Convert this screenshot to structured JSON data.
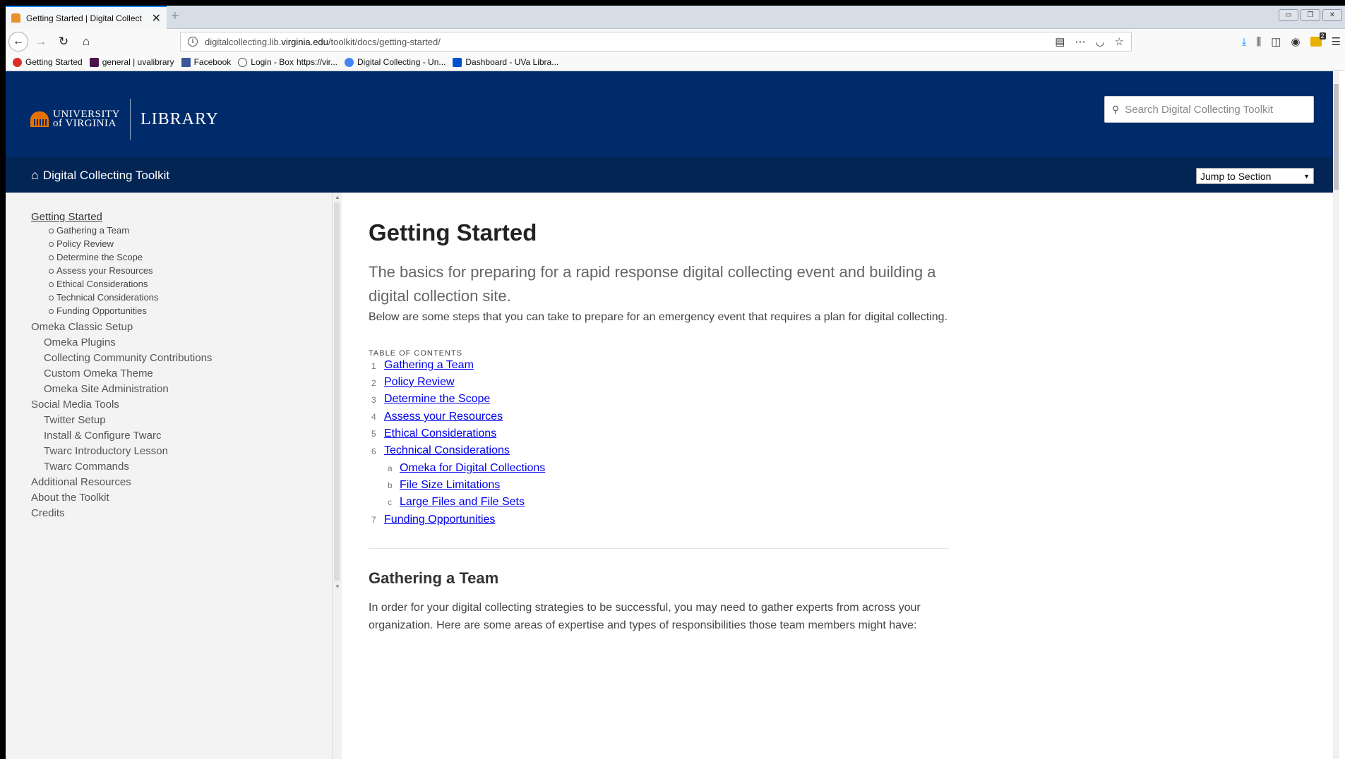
{
  "browser": {
    "tab_title": "Getting Started | Digital Collect",
    "new_tab_symbol": "+",
    "url_prefix": "digitalcollecting.lib.",
    "url_domain": "virginia.edu",
    "url_path": "/toolkit/docs/getting-started/",
    "bookmarks": [
      {
        "label": "Getting Started",
        "icon": "chrome-icon",
        "color": "#d93025"
      },
      {
        "label": "general | uvalibrary",
        "icon": "slack-icon",
        "color": "#4a154b"
      },
      {
        "label": "Facebook",
        "icon": "facebook-icon",
        "color": "#3b5998"
      },
      {
        "label": "Login - Box",
        "icon": "globe-icon",
        "color": "#555555"
      },
      {
        "label": "https://vir...",
        "icon": "",
        "color": ""
      },
      {
        "label": "Digital Collecting - Un...",
        "icon": "google-icon",
        "color": "#4285f4"
      },
      {
        "label": "Dashboard - UVa Libra...",
        "icon": "confluence-icon",
        "color": "#0052cc"
      }
    ],
    "extension_badge": "2"
  },
  "header": {
    "university_line1": "UNIVERSITY",
    "university_line2": "of VIRGINIA",
    "library": "LIBRARY",
    "search_placeholder": "Search Digital Collecting Toolkit",
    "toolkit_title": "Digital Collecting Toolkit",
    "jump_label": "Jump to Section"
  },
  "sidebar": {
    "current": "Getting Started",
    "current_sub": [
      "Gathering a Team",
      "Policy Review",
      "Determine the Scope",
      "Assess your Resources",
      "Ethical Considerations",
      "Technical Considerations",
      "Funding Opportunities"
    ],
    "items": [
      {
        "label": "Omeka Classic Setup",
        "level": 0
      },
      {
        "label": "Omeka Plugins",
        "level": 1
      },
      {
        "label": "Collecting Community Contributions",
        "level": 1
      },
      {
        "label": "Custom Omeka Theme",
        "level": 1
      },
      {
        "label": "Omeka Site Administration",
        "level": 1
      },
      {
        "label": "Social Media Tools",
        "level": 0
      },
      {
        "label": "Twitter Setup",
        "level": 1
      },
      {
        "label": "Install & Configure Twarc",
        "level": 1
      },
      {
        "label": "Twarc Introductory Lesson",
        "level": 1
      },
      {
        "label": "Twarc Commands",
        "level": 1
      },
      {
        "label": "Additional Resources",
        "level": 0
      },
      {
        "label": "About the Toolkit",
        "level": 0
      },
      {
        "label": "Credits",
        "level": 0
      }
    ]
  },
  "main": {
    "title": "Getting Started",
    "intro": "The basics for preparing for a rapid response digital collecting event and building a digital collection site.",
    "lead": "Below are some steps that you can take to prepare for an emergency event that requires a plan for digital collecting.",
    "toc_label": "TABLE OF CONTENTS",
    "toc": [
      {
        "num": "1",
        "label": "Gathering a Team",
        "level": 0
      },
      {
        "num": "2",
        "label": "Policy Review",
        "level": 0
      },
      {
        "num": "3",
        "label": "Determine the Scope",
        "level": 0
      },
      {
        "num": "4",
        "label": "Assess your Resources",
        "level": 0
      },
      {
        "num": "5",
        "label": "Ethical Considerations",
        "level": 0
      },
      {
        "num": "6",
        "label": "Technical Considerations",
        "level": 0
      },
      {
        "num": "a",
        "label": "Omeka for Digital Collections",
        "level": 1
      },
      {
        "num": "b",
        "label": "File Size Limitations",
        "level": 1
      },
      {
        "num": "c",
        "label": "Large Files and File Sets",
        "level": 1
      },
      {
        "num": "7",
        "label": "Funding Opportunities",
        "level": 0
      }
    ],
    "section_heading": "Gathering a Team",
    "section_body": "In order for your digital collecting strategies to be successful, you may need to gather experts from across your organization. Here are some areas of expertise and types of responsibilities those team members might have:"
  },
  "colors": {
    "header_bg": "#002b6a",
    "subheader_bg": "#022554",
    "accent_orange": "#e57200",
    "link": "#0000ee"
  }
}
